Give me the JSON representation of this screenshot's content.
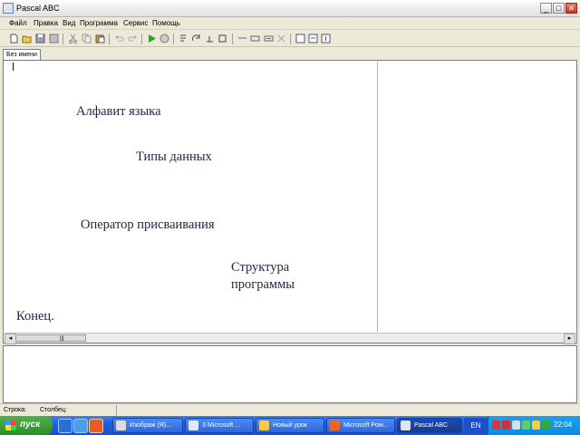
{
  "window": {
    "title": "Pascal ABC",
    "min": "_",
    "max": "□",
    "close": "✕"
  },
  "menu": [
    "Файл",
    "Правка",
    "Вид",
    "Программа",
    "Сервис",
    "Помощь"
  ],
  "tab": {
    "label": "Без имени"
  },
  "editor": {
    "lines": {
      "alphabet": "Алфавит языка",
      "types": "Типы данных",
      "assign": "Оператор присваивания",
      "struct1": "Структура",
      "struct2": "программы",
      "end": "Конец."
    }
  },
  "statusbar": {
    "row": "Строка:",
    "col": "Столбец:"
  },
  "taskbar": {
    "start": "пуск",
    "tasks": [
      "Изображ (Я)...",
      "3 Microsoft ...",
      "Новый урок",
      "Microsoft Pow...",
      "Pascal ABC"
    ],
    "lang": "EN",
    "clock": "22:04"
  }
}
